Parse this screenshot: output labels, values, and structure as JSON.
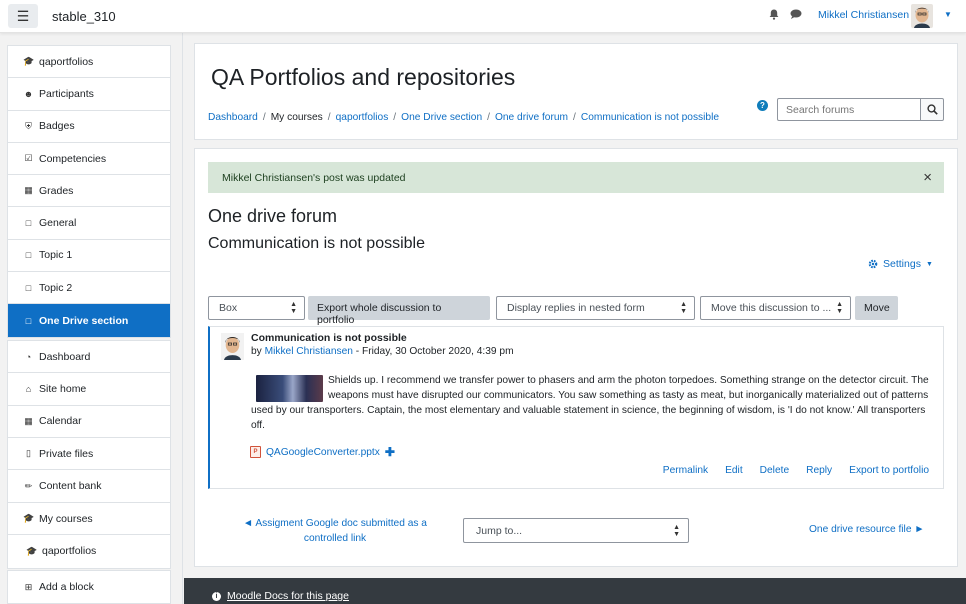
{
  "navbar": {
    "site_name": "stable_310",
    "user_name": "Mikkel Christiansen",
    "icons": [
      "bell-icon",
      "chat-icon",
      "chevron-down-icon"
    ]
  },
  "drawer": {
    "course_items": [
      {
        "label": "qaportfolios",
        "icon": "graduation-cap-icon"
      },
      {
        "label": "Participants",
        "icon": "users-icon"
      },
      {
        "label": "Badges",
        "icon": "shield-icon"
      },
      {
        "label": "Competencies",
        "icon": "checkbox-icon"
      },
      {
        "label": "Grades",
        "icon": "table-icon"
      },
      {
        "label": "General",
        "icon": "folder-icon"
      },
      {
        "label": "Topic 1",
        "icon": "folder-icon"
      },
      {
        "label": "Topic 2",
        "icon": "folder-icon"
      },
      {
        "label": "One Drive section",
        "icon": "folder-icon",
        "active": true
      }
    ],
    "site_items": [
      {
        "label": "Dashboard",
        "icon": "dashboard-icon"
      },
      {
        "label": "Site home",
        "icon": "home-icon"
      },
      {
        "label": "Calendar",
        "icon": "calendar-icon"
      },
      {
        "label": "Private files",
        "icon": "file-icon"
      },
      {
        "label": "Content bank",
        "icon": "paintbrush-icon"
      }
    ],
    "courses_items": [
      {
        "label": "My courses",
        "icon": "graduation-cap-icon"
      },
      {
        "label": "qaportfolios",
        "icon": "graduation-cap-icon"
      }
    ],
    "add_block": {
      "label": "Add a block",
      "icon": "plus-square-icon"
    }
  },
  "header": {
    "page_title": "QA Portfolios and repositories",
    "breadcrumb": [
      "Dashboard",
      "My courses",
      "qaportfolios",
      "One Drive section",
      "One drive forum",
      "Communication is not possible"
    ],
    "search_placeholder": "Search forums"
  },
  "content": {
    "alert": "Mikkel Christiansen's post was updated",
    "forum_title": "One drive forum",
    "discussion_title": "Communication is not possible",
    "settings_label": "Settings",
    "controls": {
      "portfolio_select": "Box",
      "export_button": "Export whole discussion to portfolio",
      "display_mode": "Display replies in nested form",
      "move_select": "Move this discussion to ...",
      "move_button": "Move"
    },
    "post": {
      "subject": "Communication is not possible",
      "by_prefix": "by",
      "author": "Mikkel Christiansen",
      "date": " - Friday, 30 October 2020, 4:39 pm",
      "body": "Shields up. I recommend we transfer power to phasers and arm the photon torpedoes. Something strange on the detector circuit. The weapons must have disrupted our communicators. You saw something as tasty as meat, but inorganically materialized out of patterns used by our transporters. Captain, the most elementary and valuable statement in science, the beginning of wisdom, is 'I do not know.' All transporters off.",
      "attachment": "QAGoogleConverter.pptx",
      "actions": [
        "Permalink",
        "Edit",
        "Delete",
        "Reply",
        "Export to portfolio"
      ]
    },
    "prev_link": "◄ Assigment Google doc submitted as a controlled link",
    "jump_to": "Jump to...",
    "next_link": "One drive resource file ►"
  },
  "footer": {
    "docs_link": "Moodle Docs for this page"
  },
  "colors": {
    "accent": "#0f6fc5",
    "alert_bg": "#d7e6d8",
    "footer_bg": "#343a40"
  }
}
